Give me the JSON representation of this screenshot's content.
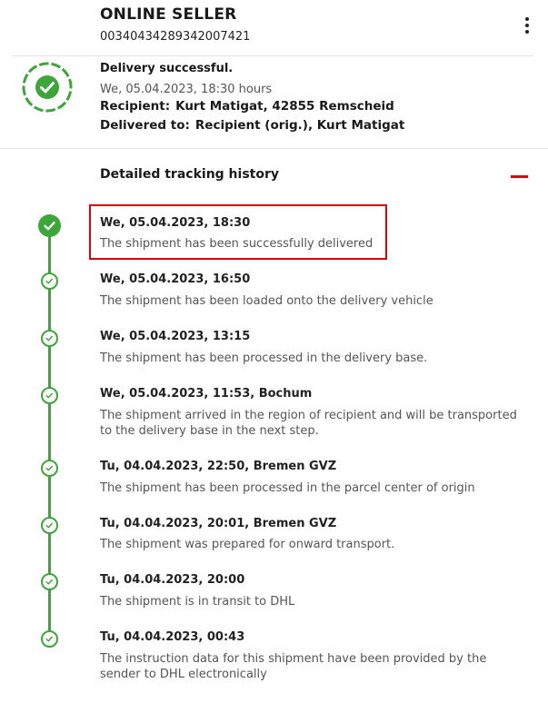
{
  "header": {
    "seller": "ONLINE SELLER",
    "tracking_number": "00340434289342007421",
    "menu_icon": "more-vertical-icon"
  },
  "status": {
    "icon": "delivered-check-icon",
    "title": "Delivery successful.",
    "time": "We, 05.04.2023, 18:30 hours",
    "recipient_label": "Recipient:",
    "recipient_value": "Kurt Matigat, 42855 Remscheid",
    "delivered_label": "Delivered to:",
    "delivered_value": "Recipient (orig.), Kurt Matigat"
  },
  "history": {
    "title": "Detailed tracking history",
    "collapse_icon": "minus-icon",
    "events": [
      {
        "time": "We, 05.04.2023, 18:30",
        "desc": "The shipment has been successfully delivered"
      },
      {
        "time": "We, 05.04.2023, 16:50",
        "desc": "The shipment has been loaded onto the delivery vehicle"
      },
      {
        "time": "We, 05.04.2023, 13:15",
        "desc": "The shipment has been processed in the delivery base."
      },
      {
        "time": "We, 05.04.2023, 11:53, Bochum",
        "desc": "The shipment arrived in the region of recipient and will be transported to the delivery base in the next step."
      },
      {
        "time": "Tu, 04.04.2023, 22:50, Bremen GVZ",
        "desc": "The shipment has been processed in the parcel center of origin"
      },
      {
        "time": "Tu, 04.04.2023, 20:01, Bremen GVZ",
        "desc": "The shipment was prepared for onward transport."
      },
      {
        "time": "Tu, 04.04.2023, 20:00",
        "desc": "The shipment is in transit to DHL"
      },
      {
        "time": "Tu, 04.04.2023, 00:43",
        "desc": "The instruction data for this shipment have been provided by the sender to DHL electronically"
      }
    ]
  },
  "colors": {
    "success_green": "#3ea53b",
    "accent_red": "#d40511"
  }
}
